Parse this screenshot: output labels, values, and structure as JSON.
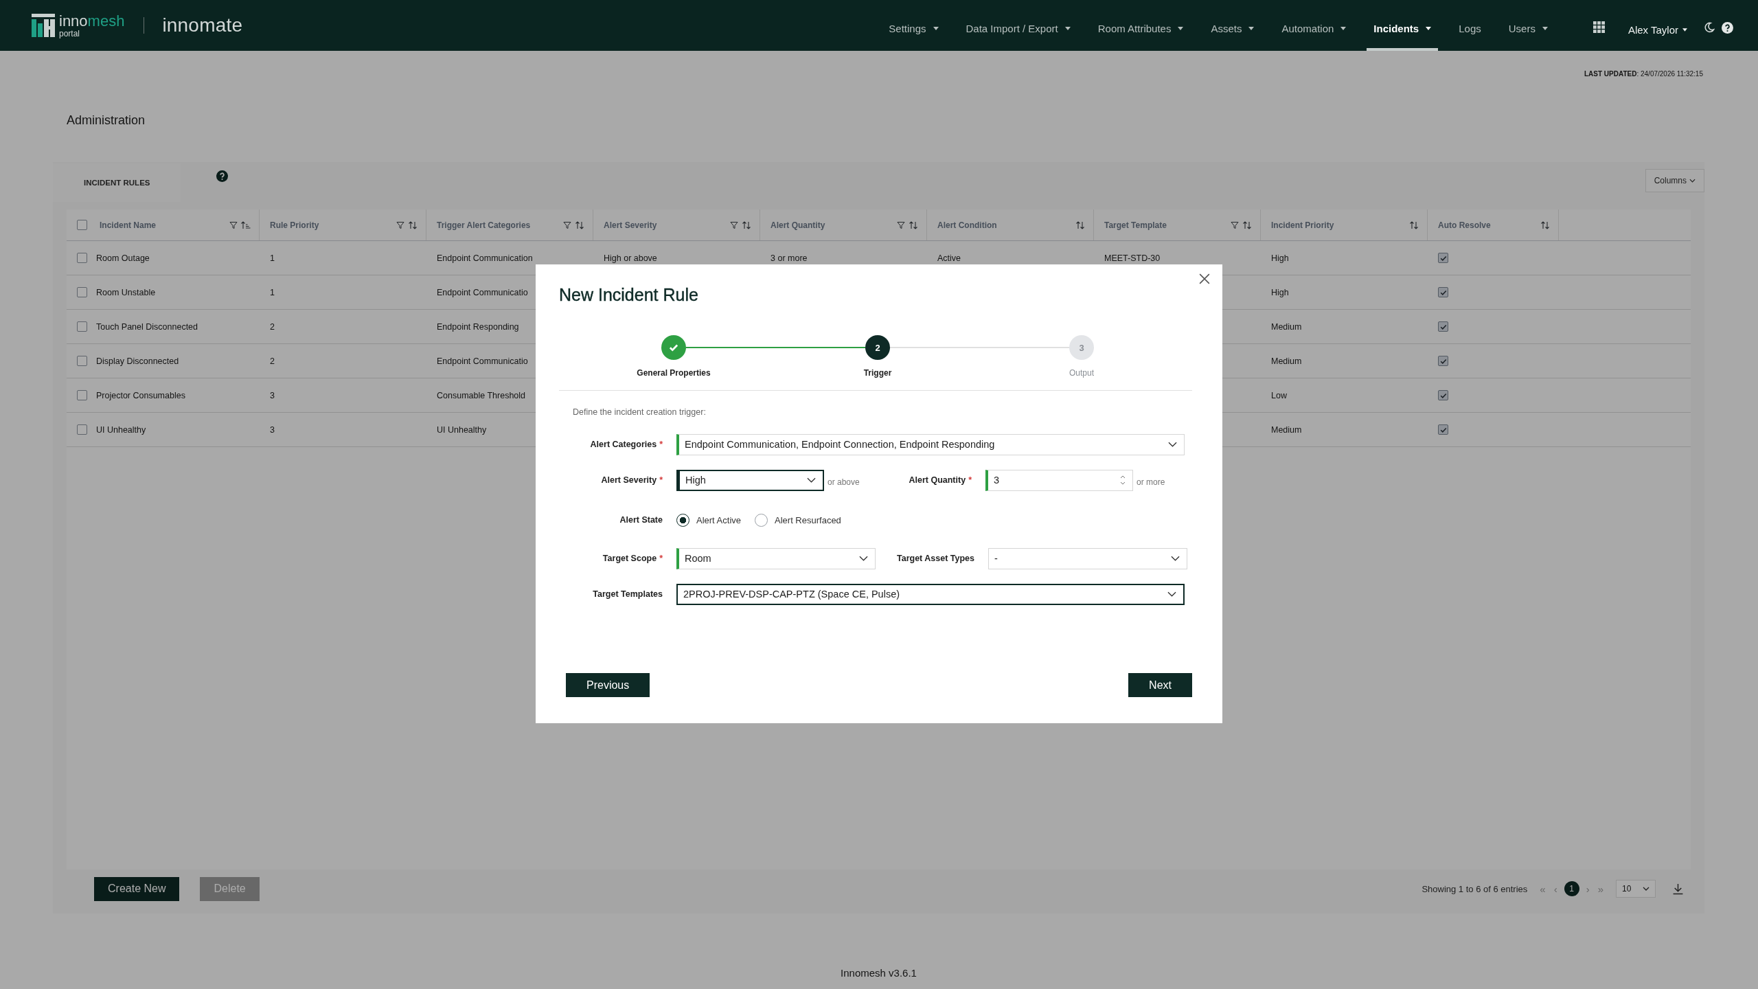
{
  "brand": {
    "wordmark": [
      "inno",
      "mesh"
    ],
    "sub": "portal",
    "app_name": "innomate"
  },
  "nav": [
    {
      "label": "Settings",
      "dropdown": true,
      "selected": false
    },
    {
      "label": "Data Import / Export",
      "dropdown": true,
      "selected": false
    },
    {
      "label": "Room Attributes",
      "dropdown": true,
      "selected": false
    },
    {
      "label": "Assets",
      "dropdown": true,
      "selected": false
    },
    {
      "label": "Automation",
      "dropdown": true,
      "selected": false
    },
    {
      "label": "Incidents",
      "dropdown": true,
      "selected": true
    },
    {
      "label": "Logs",
      "dropdown": false,
      "selected": false
    },
    {
      "label": "Users",
      "dropdown": true,
      "selected": false
    }
  ],
  "user": {
    "name": "Alex Taylor"
  },
  "last_updated": "**LAST UPDATED**: 24/07/2026 11:32:15",
  "page_title": "Administration",
  "tabs": [
    {
      "label": "INCIDENT RULES",
      "selected": true
    }
  ],
  "columns_button": "Columns",
  "table": {
    "columns": [
      {
        "label": "Incident Name",
        "filter": true,
        "sorted": true,
        "kind": "text"
      },
      {
        "label": "Rule Priority",
        "filter": true,
        "sorted": false,
        "kind": "text"
      },
      {
        "label": "Trigger Alert Categories",
        "filter": true,
        "sorted": false,
        "kind": "text"
      },
      {
        "label": "Alert Severity",
        "filter": true,
        "sorted": false,
        "kind": "text"
      },
      {
        "label": "Alert Quantity",
        "filter": true,
        "sorted": false,
        "kind": "text"
      },
      {
        "label": "Alert Condition",
        "filter": false,
        "sorted": false,
        "kind": "text"
      },
      {
        "label": "Target Template",
        "filter": true,
        "sorted": false,
        "kind": "text"
      },
      {
        "label": "Incident Priority",
        "filter": false,
        "sorted": false,
        "kind": "text"
      },
      {
        "label": "Auto Resolve",
        "filter": false,
        "sorted": false,
        "kind": "checkbox"
      }
    ],
    "header_checked": false,
    "rows": [
      {
        "checked": false,
        "cells": [
          "Room Outage",
          "1",
          "Endpoint Communication",
          "High or above",
          "3 or more",
          "Active",
          "MEET-STD-30",
          "High"
        ],
        "auto_resolve": true
      },
      {
        "checked": false,
        "cells": [
          "Room Unstable",
          "1",
          "Endpoint Communicatio",
          "High"
        ],
        "auto_resolve": true
      },
      {
        "checked": false,
        "cells": [
          "Touch Panel Disconnected",
          "2",
          "Endpoint Responding",
          "Medium"
        ],
        "auto_resolve": true
      },
      {
        "checked": false,
        "cells": [
          "Display Disconnected",
          "2",
          "Endpoint Communicatio",
          "Medium"
        ],
        "auto_resolve": true
      },
      {
        "checked": false,
        "cells": [
          "Projector Consumables",
          "3",
          "Consumable Threshold",
          "Low"
        ],
        "auto_resolve": true
      },
      {
        "checked": false,
        "cells": [
          "UI Unhealthy",
          "3",
          "UI Unhealthy",
          "Medium"
        ],
        "auto_resolve": true
      }
    ]
  },
  "actions": [
    {
      "label": "Create New",
      "disabled": false
    },
    {
      "label": "Delete",
      "disabled": true
    }
  ],
  "pagination": {
    "summary": "Showing 1 to 6 of 6 entries",
    "first": "«",
    "prev": "‹",
    "next": "›",
    "last": "»",
    "pages": [
      {
        "label": "1",
        "selected": true
      }
    ],
    "page_size": "10"
  },
  "footer": "Innomesh v3.6.1",
  "modal": {
    "title": "New Incident Rule",
    "steps": [
      {
        "label": "General Properties",
        "done": true,
        "current": false
      },
      {
        "label": "Trigger",
        "number": "2",
        "done": false,
        "current": true
      },
      {
        "label": "Output",
        "number": "3",
        "done": false,
        "current": false
      }
    ],
    "instruction": "Define the incident creation trigger:",
    "required_mark": "*",
    "rows": [
      [
        {
          "kind": "select",
          "label": "Alert Categories",
          "required": true,
          "value": "Endpoint Communication, Endpoint Connection, Endpoint Responding",
          "valid": true,
          "active": false,
          "focused": false
        }
      ],
      [
        {
          "kind": "select",
          "label": "Alert Severity",
          "required": true,
          "value": "High",
          "suffix": "or above",
          "valid": false,
          "active": true,
          "focused": true
        },
        {
          "kind": "number",
          "label": "Alert Quantity",
          "required": true,
          "value": "3",
          "suffix": "or more",
          "valid": true,
          "active": false,
          "focused": false
        }
      ],
      [
        {
          "kind": "radio",
          "label": "Alert State",
          "required": false,
          "options": [
            {
              "label": "Alert Active",
              "selected": true
            },
            {
              "label": "Alert Resurfaced",
              "selected": false
            }
          ]
        }
      ],
      [
        {
          "kind": "select",
          "label": "Target Scope",
          "required": true,
          "value": "Room",
          "valid": true,
          "active": false,
          "focused": false
        },
        {
          "kind": "select",
          "label": "Target Asset Types",
          "required": false,
          "value": "-",
          "valid": false,
          "active": false,
          "focused": false
        }
      ],
      [
        {
          "kind": "select",
          "label": "Target Templates",
          "required": false,
          "value": "2PROJ-PREV-DSP-CAP-PTZ (Space CE, Pulse)",
          "valid": false,
          "active": false,
          "focused": true
        }
      ]
    ],
    "buttons": {
      "previous": "Previous",
      "next": "Next"
    }
  }
}
